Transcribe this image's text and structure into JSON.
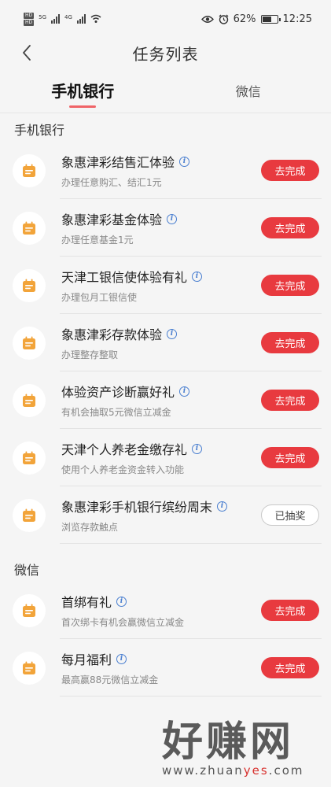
{
  "status_bar": {
    "tag1": "HD",
    "tag2": "HD",
    "net1": "5G",
    "net2": "4G",
    "battery_percent": "62%",
    "time": "12:25",
    "battery_level": 0.62
  },
  "nav": {
    "title": "任务列表"
  },
  "tabs": [
    {
      "label": "手机银行",
      "active": true
    },
    {
      "label": "微信",
      "active": false
    }
  ],
  "sections": {
    "bank": {
      "title": "手机银行",
      "tasks": [
        {
          "title": "象惠津彩结售汇体验",
          "subtitle": "办理任意购汇、结汇1元",
          "button": "去完成"
        },
        {
          "title": "象惠津彩基金体验",
          "subtitle": "办理任意基金1元",
          "button": "去完成"
        },
        {
          "title": "天津工银信使体验有礼",
          "subtitle": "办理包月工银信使",
          "button": "去完成"
        },
        {
          "title": "象惠津彩存款体验",
          "subtitle": "办理整存整取",
          "button": "去完成"
        },
        {
          "title": "体验资产诊断赢好礼",
          "subtitle": "有机会抽取5元微信立减金",
          "button": "去完成"
        },
        {
          "title": "天津个人养老金缴存礼",
          "subtitle": "使用个人养老金资金转入功能",
          "button": "去完成"
        },
        {
          "title": "象惠津彩手机银行缤纷周末",
          "subtitle": "浏览存款触点",
          "button": "已抽奖"
        }
      ]
    },
    "wechat": {
      "title": "微信",
      "tasks": [
        {
          "title": "首绑有礼",
          "subtitle": "首次绑卡有机会赢微信立减金",
          "button": "去完成"
        },
        {
          "title": "每月福利",
          "subtitle": "最高赢88元微信立减金",
          "button": "去完成"
        }
      ]
    }
  },
  "watermark": {
    "main": "好赚网",
    "sub_prefix": "www.zhuan",
    "sub_accent": "yes",
    "sub_suffix": ".com"
  },
  "colors": {
    "accent_red": "#e83a3f",
    "tab_indicator": "#f06468",
    "icon_orange": "#f2a43a",
    "info_blue": "#4a7fd0"
  }
}
